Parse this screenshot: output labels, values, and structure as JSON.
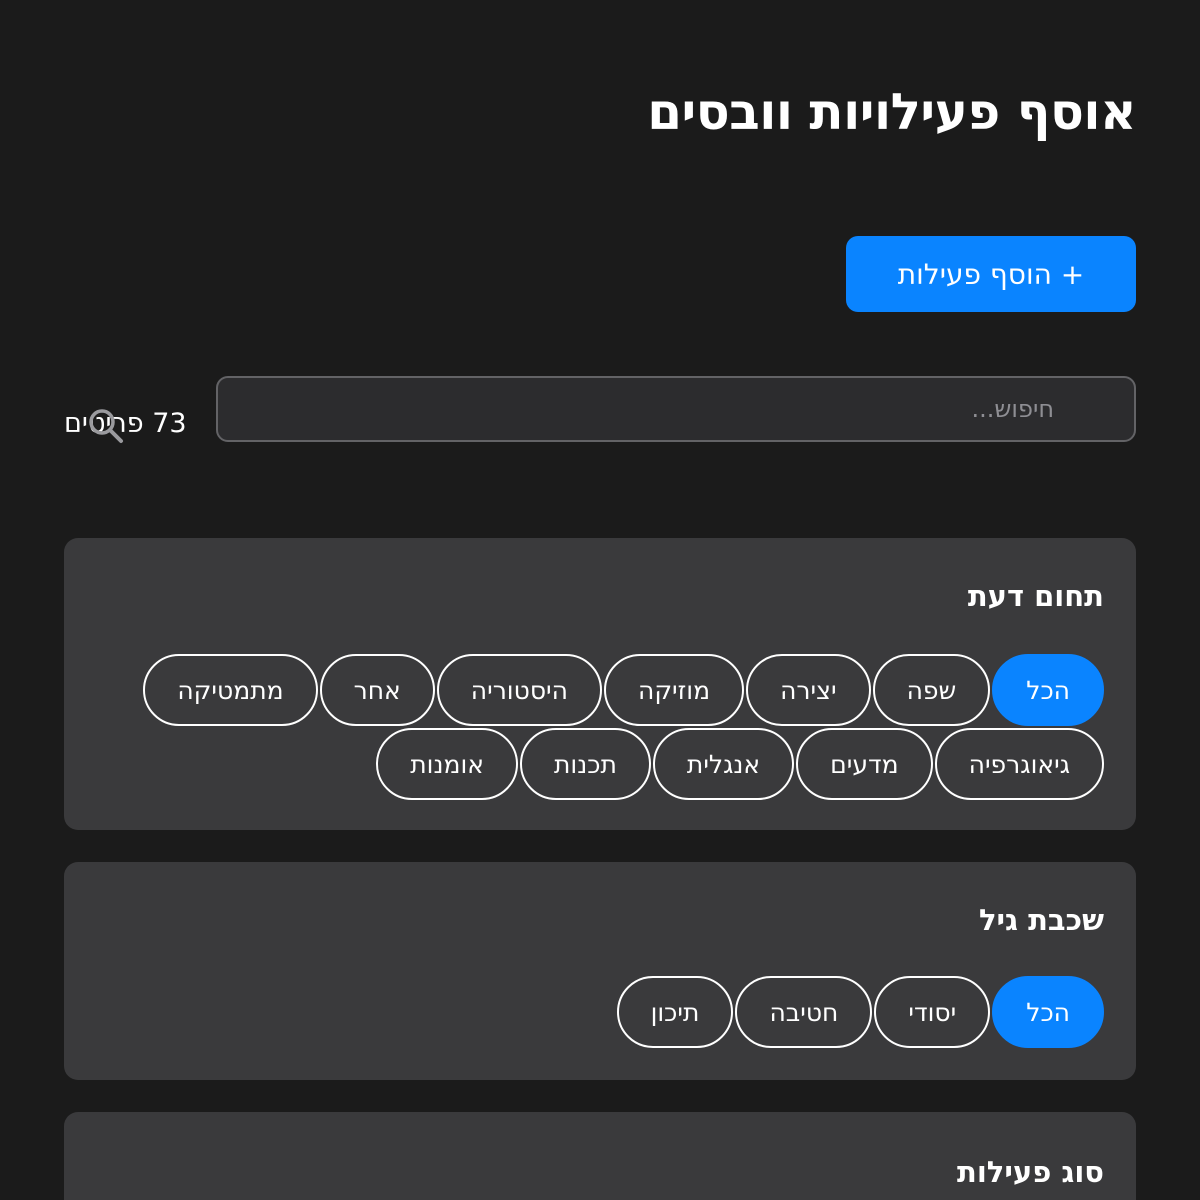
{
  "header": {
    "title": "אוסף פעילויות וובסים"
  },
  "toolbar": {
    "add_label": "+ הוסף פעילות"
  },
  "search": {
    "placeholder": "חיפוש...",
    "results_count": "73 פריטים"
  },
  "filters": {
    "subject": {
      "title": "תחום דעת",
      "options": [
        "הכל",
        "שפה",
        "יצירה",
        "מוזיקה",
        "היסטוריה",
        "אחר",
        "מתמטיקה",
        "גיאוגרפיה",
        "מדעים",
        "אנגלית",
        "תכנות",
        "אומנות"
      ],
      "selected": "הכל"
    },
    "age": {
      "title": "שכבת גיל",
      "options": [
        "הכל",
        "יסודי",
        "חטיבה",
        "תיכון"
      ],
      "selected": "הכל"
    },
    "type": {
      "title": "סוג פעילות"
    }
  },
  "colors": {
    "accent": "#0a84ff",
    "background": "#1b1b1b",
    "card": "#3a3a3c"
  },
  "icons": {
    "search": "search-icon"
  }
}
